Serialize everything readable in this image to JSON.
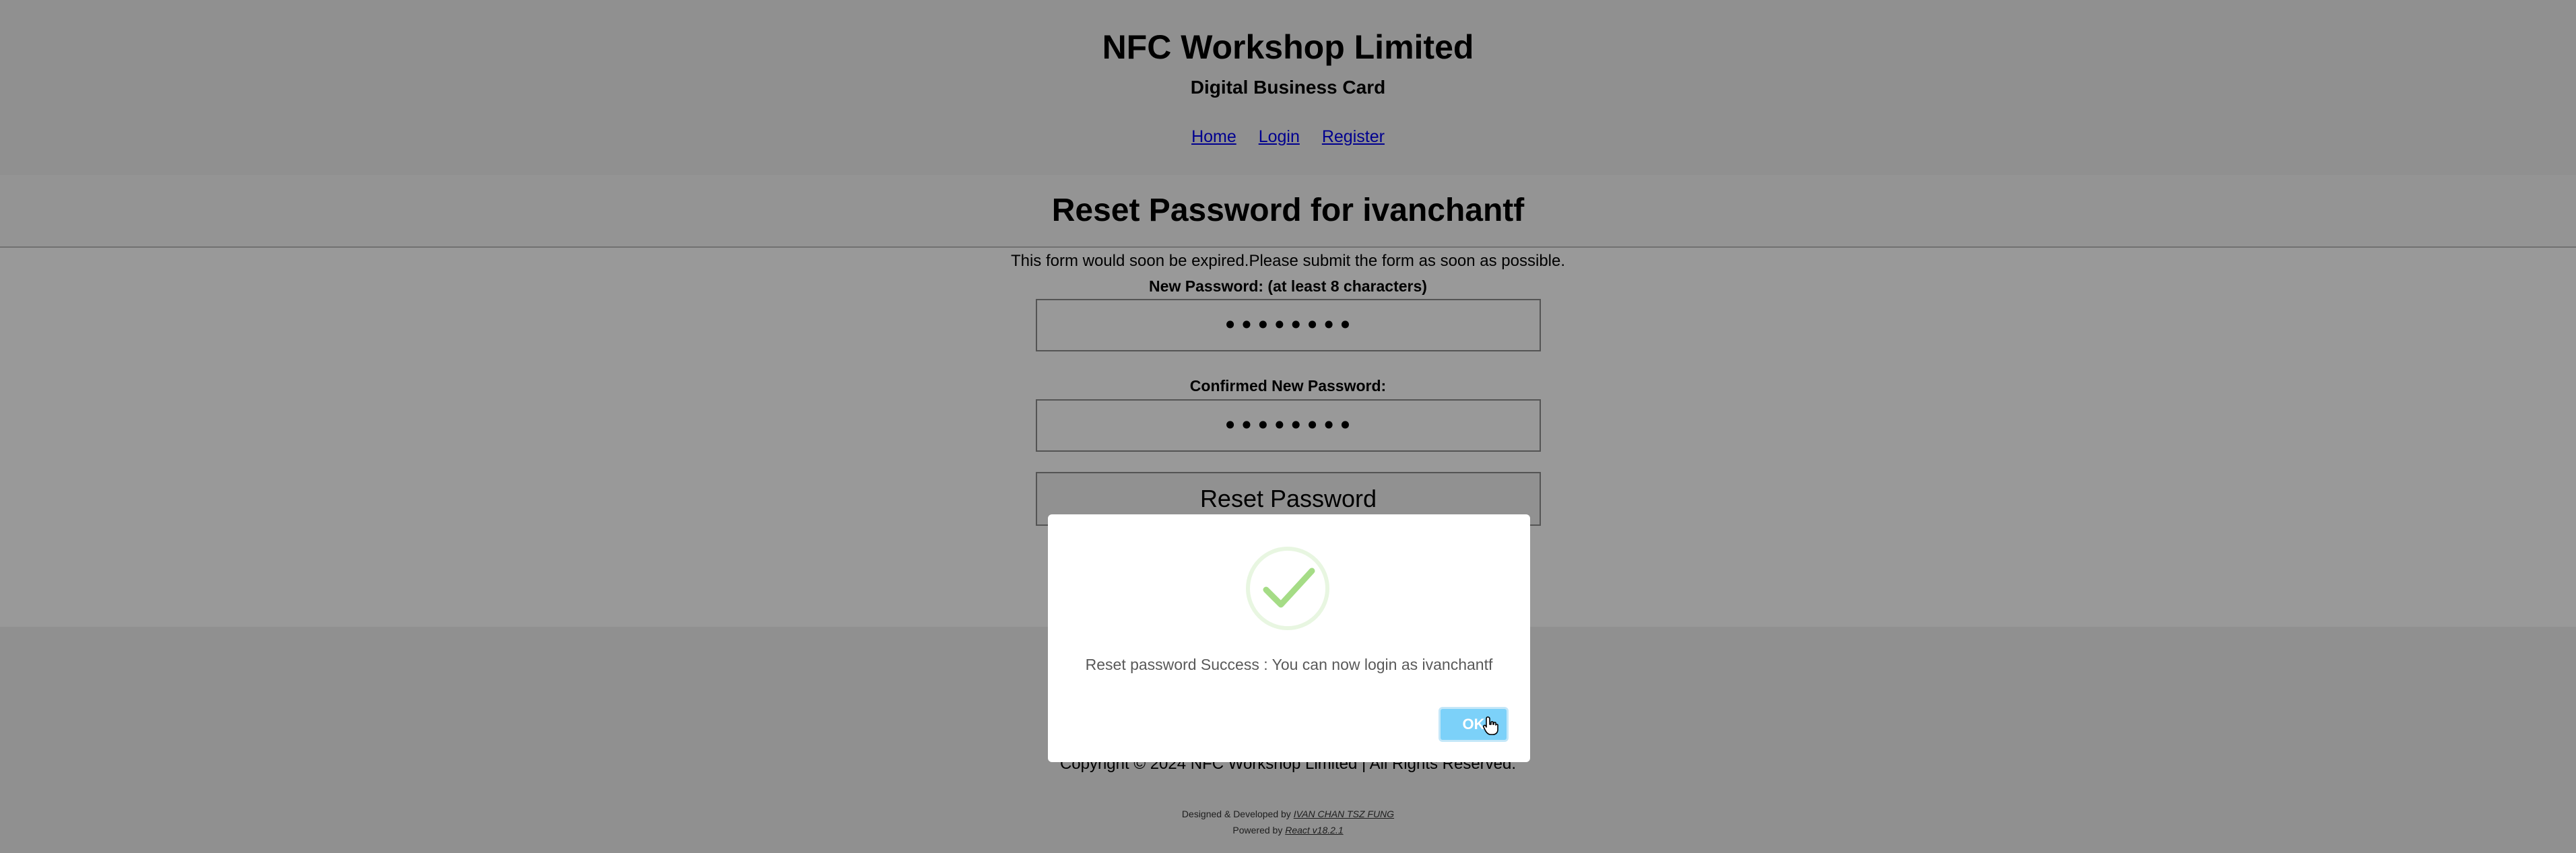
{
  "header": {
    "brand": "NFC Workshop Limited",
    "tagline": "Digital Business Card",
    "nav": [
      {
        "label": "Home"
      },
      {
        "label": "Login"
      },
      {
        "label": "Register"
      }
    ]
  },
  "form": {
    "title": "Reset Password for ivanchantf",
    "notice": "This form would soon be expired.Please submit the form as soon as possible.",
    "new_password_label": "New Password: (at least 8 characters)",
    "new_password_value": "••••••••",
    "confirm_password_label": "Confirmed New Password:",
    "confirm_password_value": "••••••••",
    "submit_label": "Reset Password"
  },
  "footer": {
    "copyright": "Copyright © 2024 NFC Workshop Limited | All Rights Reserved.",
    "designed_prefix": "Designed & Developed by",
    "designer": "IVAN CHAN TSZ FUNG",
    "powered_prefix": "Powered by",
    "powered_link": "React v18.2.1"
  },
  "modal": {
    "icon": "success-check-icon",
    "message": "Reset password Success : You can now login as ivanchantf",
    "ok_label": "OK"
  },
  "colors": {
    "ok_button": "#7cd1f9",
    "success_check": "#a5dc86",
    "overlay": "rgba(0,0,0,0.4)"
  }
}
